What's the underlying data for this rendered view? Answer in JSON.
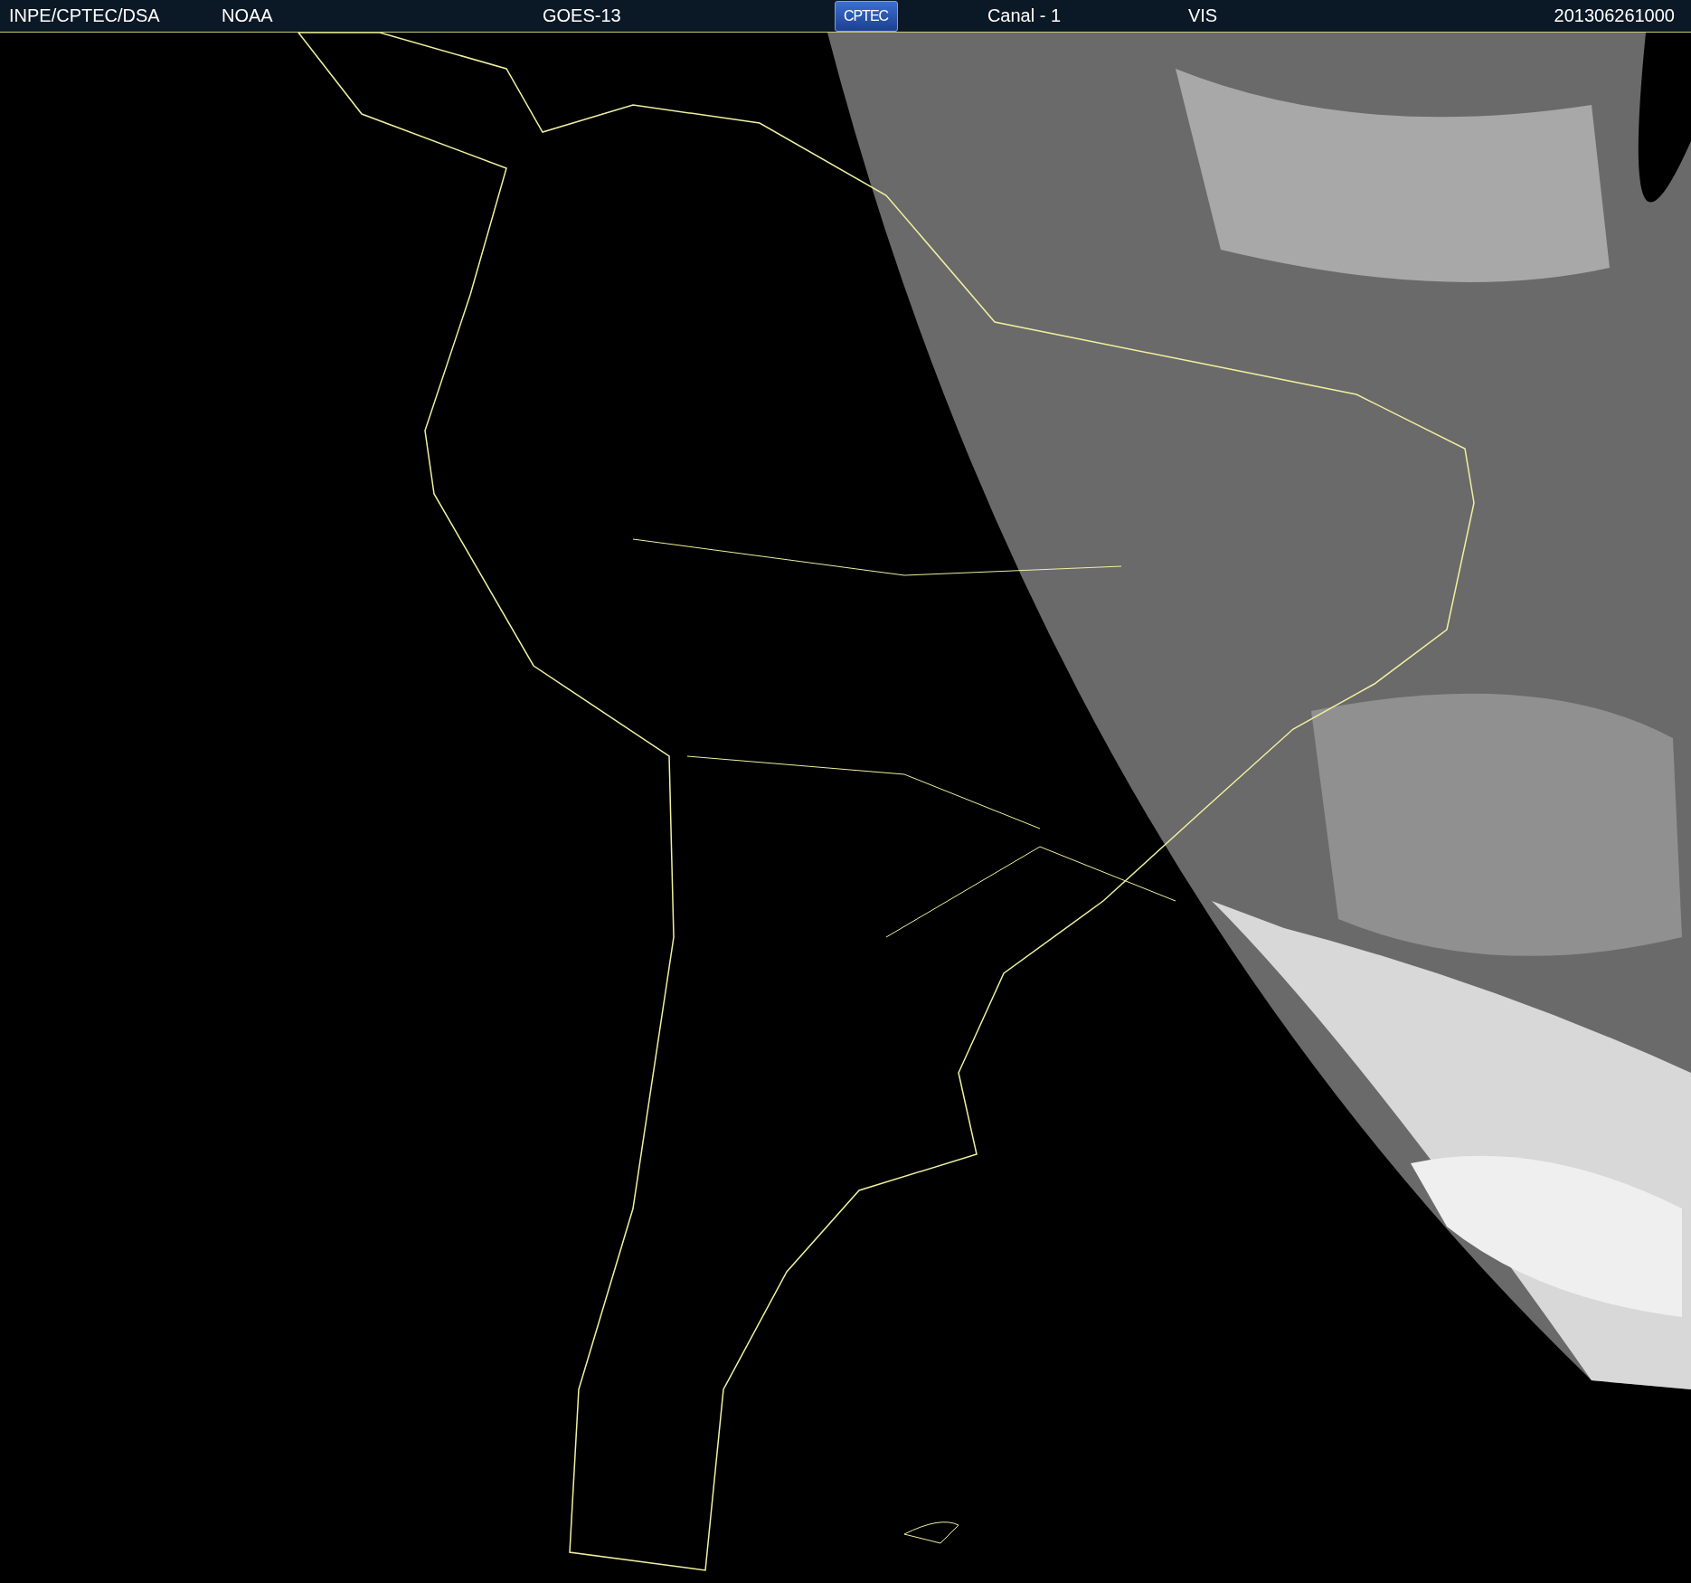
{
  "header": {
    "items": [
      {
        "kind": "text",
        "text": "INPE/CPTEC/DSA"
      },
      {
        "kind": "text",
        "text": "NOAA"
      },
      {
        "kind": "text",
        "text": "GOES-13"
      },
      {
        "kind": "logo",
        "text": "CPTEC"
      },
      {
        "kind": "text",
        "text": "Canal - 1"
      },
      {
        "kind": "text",
        "text": "VIS"
      },
      {
        "kind": "text",
        "text": "201306261000"
      }
    ]
  }
}
